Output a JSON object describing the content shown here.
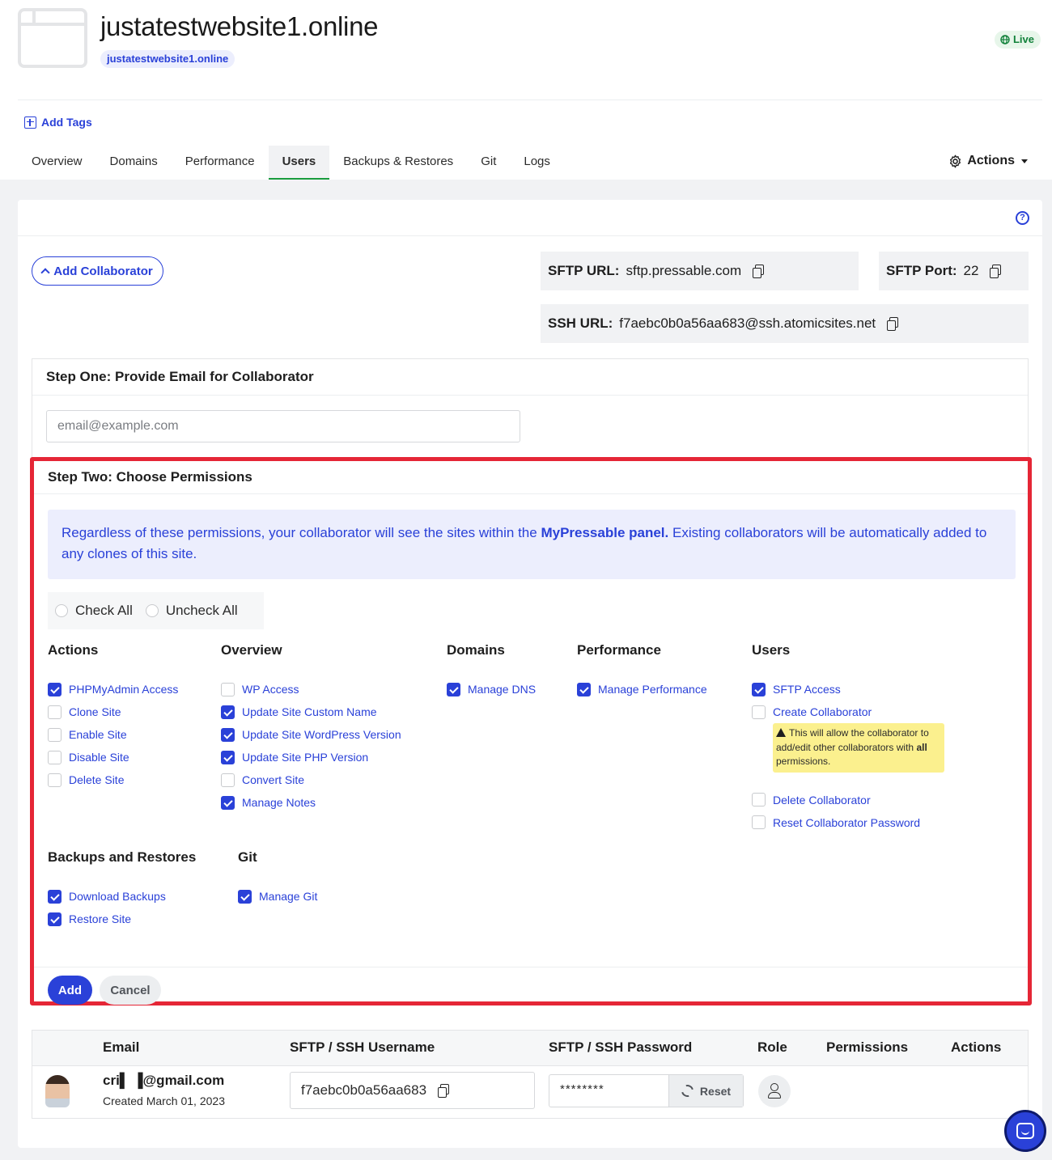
{
  "site": {
    "title": "justatestwebsite1.online",
    "domain": "justatestwebsite1.online",
    "status": "Live"
  },
  "tags": {
    "add_label": "Add Tags"
  },
  "tabs": [
    {
      "label": "Overview",
      "active": false
    },
    {
      "label": "Domains",
      "active": false
    },
    {
      "label": "Performance",
      "active": false
    },
    {
      "label": "Users",
      "active": true
    },
    {
      "label": "Backups & Restores",
      "active": false
    },
    {
      "label": "Git",
      "active": false
    },
    {
      "label": "Logs",
      "active": false
    }
  ],
  "actions_label": "Actions",
  "add_collaborator_label": "Add Collaborator",
  "sftp": {
    "url_label": "SFTP URL:",
    "url_value": "sftp.pressable.com",
    "port_label": "SFTP Port:",
    "port_value": "22",
    "ssh_label": "SSH URL:",
    "ssh_value": "f7aebc0b0a56aa683@ssh.atomicsites.net"
  },
  "step_one": {
    "title": "Step One: Provide Email for Collaborator",
    "placeholder": "email@example.com",
    "value": ""
  },
  "step_two": {
    "title": "Step Two: Choose Permissions",
    "notice_before": "Regardless of these permissions, your collaborator will see the sites within the ",
    "notice_bold": "MyPressable panel.",
    "notice_after": " Existing collaborators will be automatically added to any clones of this site.",
    "check_all": "Check All",
    "uncheck_all": "Uncheck All",
    "groups": {
      "actions": {
        "title": "Actions",
        "items": [
          {
            "label": "PHPMyAdmin Access",
            "checked": true
          },
          {
            "label": "Clone Site",
            "checked": false
          },
          {
            "label": "Enable Site",
            "checked": false
          },
          {
            "label": "Disable Site",
            "checked": false
          },
          {
            "label": "Delete Site",
            "checked": false
          }
        ]
      },
      "overview": {
        "title": "Overview",
        "items": [
          {
            "label": "WP Access",
            "checked": false
          },
          {
            "label": "Update Site Custom Name",
            "checked": true
          },
          {
            "label": "Update Site WordPress Version",
            "checked": true
          },
          {
            "label": "Update Site PHP Version",
            "checked": true
          },
          {
            "label": "Convert Site",
            "checked": false
          },
          {
            "label": "Manage Notes",
            "checked": true
          }
        ]
      },
      "domains": {
        "title": "Domains",
        "items": [
          {
            "label": "Manage DNS",
            "checked": true
          }
        ]
      },
      "performance": {
        "title": "Performance",
        "items": [
          {
            "label": "Manage Performance",
            "checked": true
          }
        ]
      },
      "users": {
        "title": "Users",
        "items": [
          {
            "label": "SFTP Access",
            "checked": true
          },
          {
            "label": "Create Collaborator",
            "checked": false
          },
          {
            "label": "Delete Collaborator",
            "checked": false
          },
          {
            "label": "Reset Collaborator Password",
            "checked": false
          }
        ],
        "warning_before": "This will allow the collaborator to add/edit other collaborators with ",
        "warning_bold": "all",
        "warning_after": " permissions."
      },
      "backups": {
        "title": "Backups and Restores",
        "items": [
          {
            "label": "Download Backups",
            "checked": true
          },
          {
            "label": "Restore Site",
            "checked": true
          }
        ]
      },
      "git": {
        "title": "Git",
        "items": [
          {
            "label": "Manage Git",
            "checked": true
          }
        ]
      }
    },
    "add_label": "Add",
    "cancel_label": "Cancel"
  },
  "table": {
    "headers": {
      "email": "Email",
      "username": "SFTP / SSH Username",
      "password": "SFTP / SSH Password",
      "role": "Role",
      "permissions": "Permissions",
      "actions": "Actions"
    },
    "rows": [
      {
        "email": "cri▌ ▐@gmail.com",
        "created": "Created March 01, 2023",
        "username": "f7aebc0b0a56aa683",
        "password": "********",
        "reset_label": "Reset"
      }
    ]
  },
  "colors": {
    "accent": "#2a41d8",
    "highlight_border": "#e52636",
    "live_green": "#11813a",
    "warning_bg": "#fbf08e"
  }
}
